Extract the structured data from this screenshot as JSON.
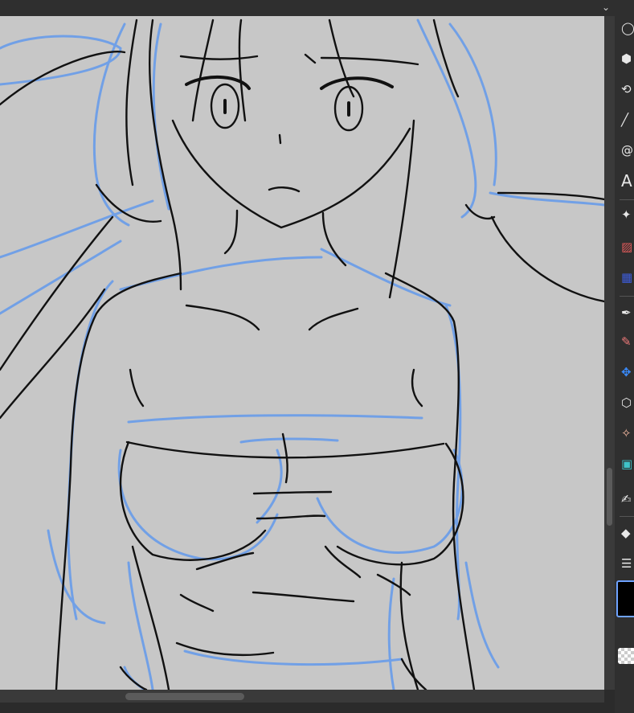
{
  "window": {
    "menu_icon": "chevron-down-icon"
  },
  "canvas": {
    "background": "#c7c7c7",
    "sketch_color": "#6d9ee8",
    "ink_color": "#111111"
  },
  "toolbar": {
    "tools": [
      {
        "name": "ellipse-select-icon",
        "glyph": "◯"
      },
      {
        "name": "3d-object-icon",
        "glyph": "⬢"
      },
      {
        "name": "lasso-icon",
        "glyph": "⟲"
      },
      {
        "name": "line-tool-icon",
        "glyph": "╱"
      },
      {
        "name": "spiral-icon",
        "glyph": "@"
      },
      {
        "name": "text-tool-icon",
        "glyph": "A"
      },
      {
        "name": "sparkle-icon",
        "glyph": "✦"
      },
      {
        "name": "hatch-brush-icon",
        "glyph": "▨"
      },
      {
        "name": "dot-tone-icon",
        "glyph": "▦"
      },
      {
        "name": "pen-icon",
        "glyph": "✒"
      },
      {
        "name": "pencil-red-icon",
        "glyph": "✎"
      },
      {
        "name": "move-icon",
        "glyph": "✥"
      },
      {
        "name": "cube-icon",
        "glyph": "⬡"
      },
      {
        "name": "star-decoration-icon",
        "glyph": "✧"
      },
      {
        "name": "image-tool-icon",
        "glyph": "▣"
      },
      {
        "name": "brush-icon",
        "glyph": "✍"
      },
      {
        "name": "eraser-icon",
        "glyph": "◆"
      },
      {
        "name": "layers-icon",
        "glyph": "☰"
      }
    ],
    "main_color": "#000000",
    "sub_color": "transparent"
  }
}
